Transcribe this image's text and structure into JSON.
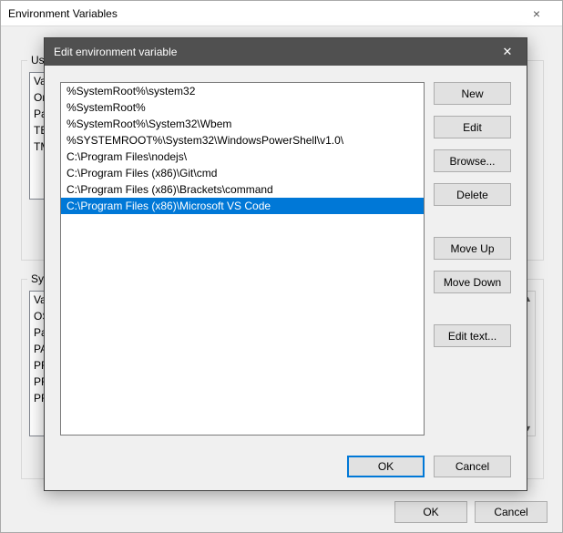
{
  "parent": {
    "title": "Environment Variables",
    "close_glyph": "×",
    "user_group_label": "User",
    "sys_group_label": "Syste",
    "user_rows": [
      "Va",
      "Or",
      "Pa",
      "TE",
      "TM"
    ],
    "sys_rows": [
      "Va",
      "OS",
      "Pa",
      "PA",
      "PR",
      "PR",
      "PR"
    ],
    "scroll_up": "▲",
    "scroll_down": "▼",
    "ok_label": "OK",
    "cancel_label": "Cancel"
  },
  "modal": {
    "title": "Edit environment variable",
    "close_glyph": "✕",
    "items": [
      "%SystemRoot%\\system32",
      "%SystemRoot%",
      "%SystemRoot%\\System32\\Wbem",
      "%SYSTEMROOT%\\System32\\WindowsPowerShell\\v1.0\\",
      "C:\\Program Files\\nodejs\\",
      "C:\\Program Files (x86)\\Git\\cmd",
      "C:\\Program Files (x86)\\Brackets\\command",
      "C:\\Program Files (x86)\\Microsoft VS Code"
    ],
    "selected_index": 7,
    "buttons": {
      "new": "New",
      "edit": "Edit",
      "browse": "Browse...",
      "delete": "Delete",
      "move_up": "Move Up",
      "move_down": "Move Down",
      "edit_text": "Edit text..."
    },
    "ok_label": "OK",
    "cancel_label": "Cancel"
  }
}
